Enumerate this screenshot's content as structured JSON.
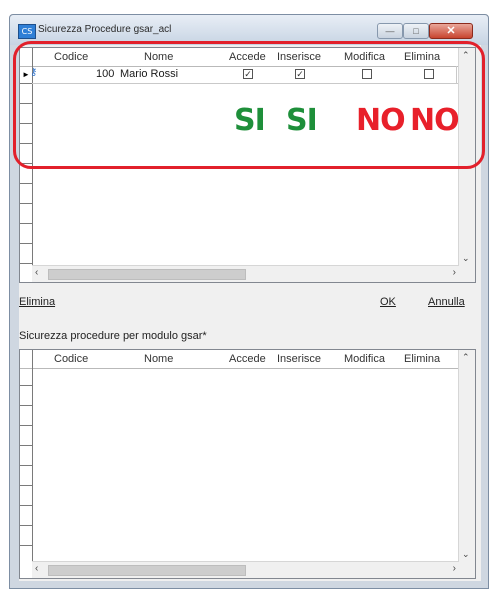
{
  "window": {
    "title": "Sicurezza Procedure gsar_acl",
    "app_icon": "app-icon",
    "app_icon_text": "CS",
    "controls": {
      "minimize": "—",
      "maximize": "□",
      "close": "✕"
    }
  },
  "grid_top": {
    "columns": [
      "Codice",
      "Nome",
      "Accede",
      "Inserisce",
      "Modifica",
      "Elimina"
    ],
    "rows": [
      {
        "codice": "100",
        "nome": "Mario Rossi",
        "accede": true,
        "inserisce": true,
        "modifica": false,
        "elimina": false
      }
    ]
  },
  "actions": {
    "delete_label": "Elimina",
    "ok_label": "OK",
    "cancel_label": "Annulla"
  },
  "section_label": "Sicurezza procedure per modulo gsar*",
  "grid_bottom": {
    "columns": [
      "Codice",
      "Nome",
      "Accede",
      "Inserisce",
      "Modifica",
      "Elimina"
    ]
  },
  "annotations": {
    "accede": "SI",
    "inserisce": "SI",
    "modifica": "NO",
    "elimina": "NO",
    "colors": {
      "si": "#1e8f3a",
      "no": "#e8202a",
      "frame": "#e2202b"
    }
  }
}
